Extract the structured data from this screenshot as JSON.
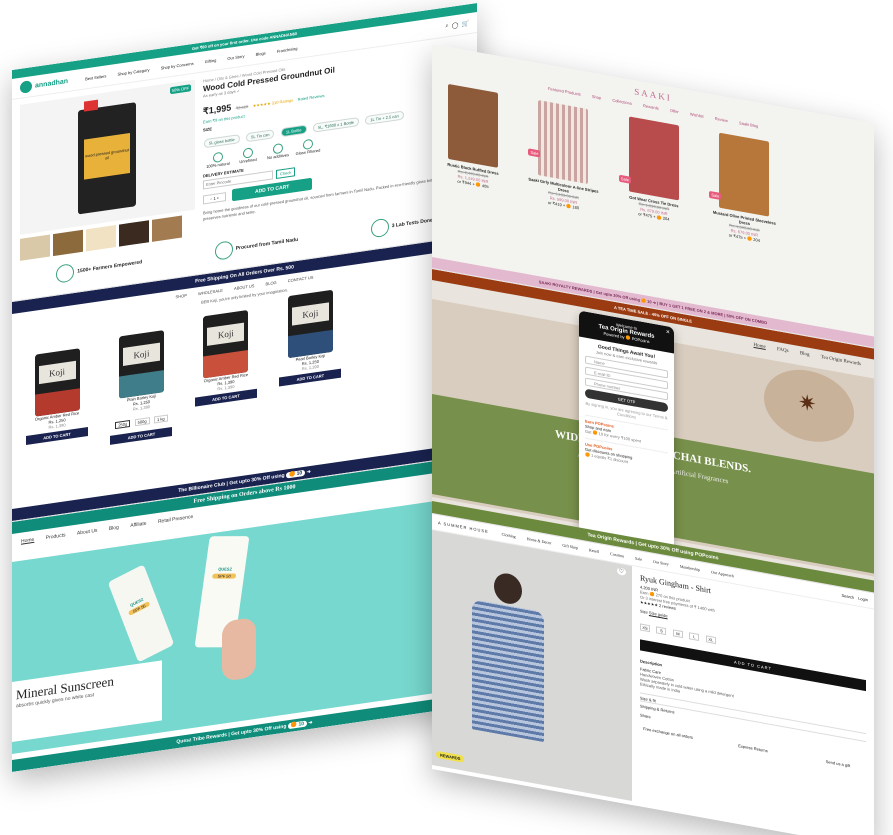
{
  "colors": {
    "annadhan_green": "#16a085",
    "billionaire_navy": "#1a2350",
    "quest_teal": "#0f8c7a",
    "saaki_pink": "#c46b93",
    "tea_red": "#9b3b12",
    "tea_green": "#6b8a3e",
    "summer_black": "#111111"
  },
  "annadhan": {
    "promo_bar": "Get ₹60 off on your first order. Use code ANNADHAN60",
    "logo": "annadhan",
    "nav": [
      "Best Sellers",
      "Shop by Category",
      "Shop by Concerns",
      "Gifting",
      "Our Story",
      "Blogs",
      "Franchising"
    ],
    "breadcrumb": "Home / Oils & Ghee / Wood Cold Pressed Oils",
    "badge": "50% OFF",
    "title": "Wood Cold Pressed Groundnut Oil",
    "subtitle": "As early as 3 days ✓",
    "price": "₹1,995",
    "old_price": "₹2,520",
    "rating": "★★★★★ 310 Ratings",
    "ratings_suffix": "Rated Reviews",
    "earn": "Earn ₹9 on this product",
    "size_label": "SIZE",
    "sizes": [
      "5L glass bottle",
      "5L Tin can",
      "1L Bottle",
      "5L, ₹1600 x 1 Bottle",
      "1L Tin + 2.5 can"
    ],
    "features": [
      "100% natural",
      "Unrefined",
      "No additives",
      "Glass Filtered"
    ],
    "delivery_label": "DELIVERY ESTIMATE",
    "pincode_placeholder": "Enter Pincode",
    "check": "Check",
    "qty": "1",
    "add_to_cart": "ADD TO CART",
    "description": "Bring home the goodness of our cold-pressed groundnut oil, sourced from farmers in Tamil Nadu. Packed in eco-friendly glass bottles and tin cans, it preserves nutrients and taste.",
    "pack_label": "wood pressed groundnut oil",
    "stats": [
      "1500+ Farmers Empowered",
      "Procured from Tamil Nadu",
      "3 Lab Tests Done"
    ]
  },
  "billionaire": {
    "ship_bar": "Free Shipping On All Orders Over Rs. 500",
    "nav": [
      "SHOP",
      "WHOLESALE",
      "ABOUT US",
      "BLOG",
      "CONTACT US"
    ],
    "tagline": "BEB Koji, you're only limited by your imagination.",
    "products": [
      {
        "name": "Organic Amber Red Rice",
        "price": "Rs. 1,250",
        "old": "Rs. 1,390",
        "color": "#b53a2e"
      },
      {
        "name": "Plain Barley Koji",
        "price": "Rs. 1,250",
        "old": "Rs. 1,390",
        "color": "#3f7d8a"
      },
      {
        "name": "Organic Amber Red Rice",
        "price": "Rs. 1,390",
        "old": "Rs. 1,390",
        "color": "#c9503b"
      },
      {
        "name": "Pearl Barley Koji",
        "price": "Rs. 1,250",
        "old": "Rs. 1,390",
        "color": "#2d4f7a"
      }
    ],
    "koji": "Koji",
    "add_to_cart": "ADD TO CART",
    "weight_options": [
      "250g",
      "500g",
      "1 kg"
    ],
    "club_bar": "The Billionaire Club | Get upto 30% Off using",
    "club_points": "10"
  },
  "quest": {
    "ship_bar": "Free Shipping on Orders above Rs 1000",
    "nav": [
      "Home",
      "Products",
      "About Us",
      "Blog",
      "Affiliate",
      "Retail Presence"
    ],
    "title": "Mineral Sunscreen",
    "subtitle": "absorbs quickly gives no white cast",
    "tube_brand": "QUESZ",
    "spf": "SPF 50",
    "rewards_bar": "Quesz Tribe Rewards | Get upto 30% Off using",
    "rewards_points": "10"
  },
  "saaki": {
    "logo": "SAAKI",
    "nav": [
      "Featured Products",
      "Shop",
      "Collections",
      "Rewards",
      "Offer",
      "Wishlist",
      "Review",
      "Saaki Blog"
    ],
    "products": [
      {
        "name": "Rustic Black Ruffled Dress",
        "price": "Rs. 1,249.00 INR",
        "old": "Rs. 2,499.00 INR",
        "or": "or ₹944 + 🟠 405",
        "color": "#8d5a3a",
        "badge": "Sale"
      },
      {
        "name": "Saaki Girly Multicolour A-line Stripes Dress",
        "price": "Rs. 599.00 INR",
        "old": "Rs. 1,199.00 INR",
        "or": "or ₹419 + 🟠 180",
        "color": "#c9a4a0",
        "badge": "Sale"
      },
      {
        "name": "Got Wear Cross Tie Dress",
        "price": "Rs. 679.00 INR",
        "old": "Rs. 1,899.00 INR",
        "or": "or ₹475 + 🟠 204",
        "color": "#b84b4b",
        "badge": "Sale"
      },
      {
        "name": "Mustard Olive Printed Sleeveless Dress",
        "price": "Rs. 679.00 INR",
        "old": "Rs. 1,899.00 INR",
        "or": "or ₹475 + 🟠 204",
        "color": "#b7763a",
        "badge": "Sale"
      }
    ],
    "rewards_bar": "SAAKI ROYALTY REWARDS | Get upto 30% Off using",
    "rewards_points": "10",
    "offer_bar": "BUY 1 GET 1 FREE ON 2 & MORE | 50% OFF ON COMBO"
  },
  "tea": {
    "sale_bar": "A TEA TIME SALE - 40% OFF ON SINGLE",
    "nav": [
      "Home",
      "FAQs",
      "Blog",
      "Tea Origin Rewards"
    ],
    "hero_title": "WIDE SELECTION OF CHAI BLENDS.",
    "hero_sub": "Assam CTC | Whole Spices | No Artificial Fragrances",
    "popup": {
      "welcome": "Welcome to",
      "title": "Tea Origin Rewards",
      "powered": "Powered by 🟠 POPcoins",
      "good_things": "Good Things Await You!",
      "sub": "Join now & earn exclusive rewards",
      "name": "Name",
      "email": "E-mail ID",
      "phone": "Phone number",
      "get_otp": "GET OTP",
      "terms": "By signing in, you are agreeing to our Terms & Conditions",
      "earn_head": "Earn POPcoins",
      "earn_text": "Shop and earn",
      "earn_note": "Get 🟠 10 for every ₹100 spent",
      "use_head": "Use POPcoins",
      "use_text": "Get discounts on shopping",
      "use_note": "🟠 1 equals ₹1 discount"
    },
    "rewards_bar": "Tea Origin Rewards | Get upto 30% Off using POPcoins"
  },
  "summer": {
    "logo": "A SUMMER HOUSE",
    "nav": [
      "Clothing",
      "Home & Decor",
      "Gift Shop",
      "Resell",
      "Curation",
      "Sale",
      "Our Story",
      "Membership",
      "Our Approach"
    ],
    "search": "Search",
    "login": "Login",
    "title": "Ryuk Gingham - Shirt",
    "price": "4,200 INR",
    "earn": "Earn 🟠 270 on this product",
    "installments": "Or 3 interest free payments of ₹ 1400 with",
    "rating": "★★★★★ 2 reviews",
    "size_label": "Size",
    "size_guide": "Size guide",
    "sizes": [
      "XS",
      "S",
      "M",
      "L",
      "XL"
    ],
    "add_to_cart": "ADD TO CART",
    "description_head": "Description",
    "fabric_head": "Fabric Care",
    "fabric_lines": [
      "Handwoven Cotton",
      "Wash separately in cold water using a mild detergent",
      "Ethically made in India"
    ],
    "size_fit": "Size & fit",
    "shipping": "Shipping & Returns",
    "share": "Share",
    "features": [
      "Free exchange on all orders",
      "Express Returns",
      "Send us a gift"
    ],
    "sticker": "REWARDS"
  }
}
